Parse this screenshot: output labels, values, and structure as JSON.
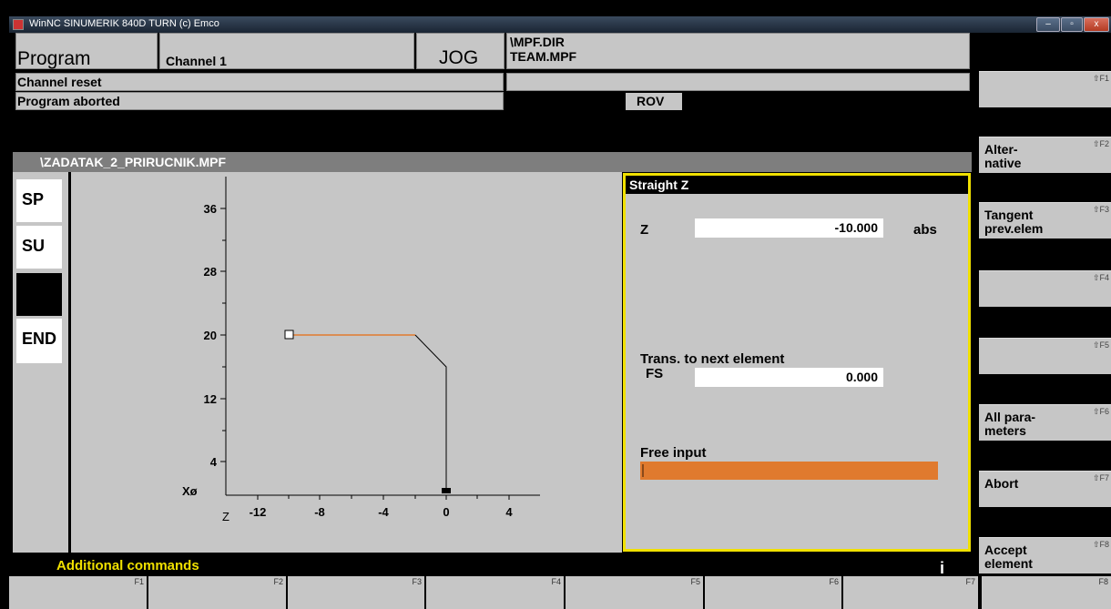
{
  "window": {
    "title": "WinNC SINUMERIK 840D TURN (c) Emco",
    "min": "–",
    "max": "▫",
    "close": "x"
  },
  "header": {
    "area": "Program",
    "channel": "Channel 1",
    "mode": "JOG",
    "path_dir": "\\MPF.DIR",
    "path_file": "TEAM.MPF",
    "status1": "Channel reset",
    "status2": "Program aborted",
    "rov": "ROV"
  },
  "editor": {
    "file_title": "\\ZADATAK_2_PRIRUCNIK.MPF",
    "side_buttons": [
      "SP",
      "SU",
      "",
      "END"
    ]
  },
  "graph": {
    "y_ticks": [
      "36",
      "28",
      "20",
      "12",
      "4"
    ],
    "x_ticks": [
      "-12",
      "-8",
      "-4",
      "0",
      "4"
    ],
    "x_axis_label": "Z",
    "y_axis_label": "Xø"
  },
  "dialog": {
    "title": "Straight Z",
    "z_label": "Z",
    "z_value": "-10.000",
    "z_unit": "abs",
    "trans_label": "Trans. to next element",
    "fs_label": "FS",
    "fs_value": "0.000",
    "free_input_label": "Free input"
  },
  "right_softkeys": [
    {
      "line1": "",
      "line2": "",
      "num": "⇧F1"
    },
    {
      "line1": "Alter-",
      "line2": "native",
      "num": "⇧F2"
    },
    {
      "line1": "Tangent",
      "line2": "prev.elem",
      "num": "⇧F3"
    },
    {
      "line1": "",
      "line2": "",
      "num": "⇧F4"
    },
    {
      "line1": "",
      "line2": "",
      "num": "⇧F5"
    },
    {
      "line1": "All para-",
      "line2": "meters",
      "num": "⇧F6"
    },
    {
      "line1": "Abort",
      "line2": "",
      "num": "⇧F7"
    },
    {
      "line1": "Accept",
      "line2": "element",
      "num": "⇧F8"
    }
  ],
  "footer": {
    "additional": "Additional commands",
    "info": "i",
    "hkeys": [
      "F1",
      "F2",
      "F3",
      "F4",
      "F5",
      "F6",
      "F7",
      "F8"
    ]
  },
  "colors": {
    "accent_orange": "#e07a2e",
    "dialog_border": "#f0e000",
    "panel_gray": "#c6c6c6"
  }
}
